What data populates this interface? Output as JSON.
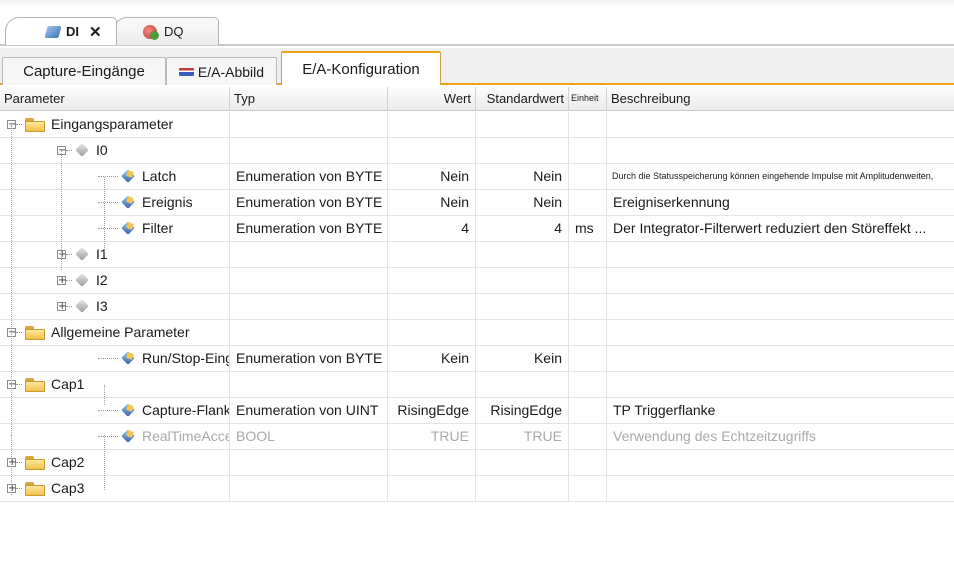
{
  "doc_tabs": [
    {
      "label": "DI",
      "icon": "di-module-icon",
      "close": "✕"
    },
    {
      "label": "DQ",
      "icon": "dq-module-icon"
    }
  ],
  "sub_tabs": [
    {
      "label": "Capture-Eingänge"
    },
    {
      "label": "E/A-Abbild",
      "icon": "io-image-icon"
    },
    {
      "label": "E/A-Konfiguration",
      "active": true
    }
  ],
  "columns": [
    "Parameter",
    "Typ",
    "Wert",
    "Standardwert",
    "Einheit",
    "Beschreibung"
  ],
  "rows": [
    {
      "label": "Eingangsparameter",
      "level": 0,
      "expander": "−",
      "icon": "folder-icon",
      "typ": "",
      "wert": "",
      "std": "",
      "einheit": "",
      "desc": ""
    },
    {
      "label": "I0",
      "level": 1,
      "expander": "−",
      "icon": "channel-icon",
      "typ": "",
      "wert": "",
      "std": "",
      "einheit": "",
      "desc": ""
    },
    {
      "label": "Latch",
      "level": 2,
      "expander": "",
      "icon": "parameter-icon",
      "typ": "Enumeration von BYTE",
      "wert": "Nein",
      "std": "Nein",
      "einheit": "",
      "desc": "Durch die Statusspeicherung können eingehende Impulse mit Amplitudenweiten,",
      "desc_small": true
    },
    {
      "label": "Ereignis",
      "level": 2,
      "expander": "",
      "icon": "parameter-icon",
      "typ": "Enumeration von BYTE",
      "wert": "Nein",
      "std": "Nein",
      "einheit": "",
      "desc": "Ereigniserkennung"
    },
    {
      "label": "Filter",
      "level": 2,
      "expander": "",
      "icon": "parameter-icon",
      "typ": "Enumeration von BYTE",
      "wert": "4",
      "std": "4",
      "einheit": "ms",
      "desc": "Der Integrator-Filterwert reduziert den Störeffekt ..."
    },
    {
      "label": "I1",
      "level": 1,
      "expander": "+",
      "icon": "channel-icon",
      "typ": "",
      "wert": "",
      "std": "",
      "einheit": "",
      "desc": ""
    },
    {
      "label": "I2",
      "level": 1,
      "expander": "+",
      "icon": "channel-icon",
      "typ": "",
      "wert": "",
      "std": "",
      "einheit": "",
      "desc": ""
    },
    {
      "label": "I3",
      "level": 1,
      "expander": "+",
      "icon": "channel-icon",
      "typ": "",
      "wert": "",
      "std": "",
      "einheit": "",
      "desc": ""
    },
    {
      "label": "Allgemeine Parameter",
      "level": 0,
      "expander": "−",
      "icon": "folder-icon",
      "typ": "",
      "wert": "",
      "std": "",
      "einheit": "",
      "desc": ""
    },
    {
      "label": "Run/Stop-Eingang",
      "level": 2,
      "expander": "",
      "icon": "parameter-icon",
      "typ": "Enumeration von BYTE",
      "wert": "Kein",
      "std": "Kein",
      "einheit": "",
      "desc": ""
    },
    {
      "label": "Cap1",
      "level": 0,
      "expander": "−",
      "icon": "folder-icon",
      "typ": "",
      "wert": "",
      "std": "",
      "einheit": "",
      "desc": ""
    },
    {
      "label": "Capture-Flanke",
      "level": 2,
      "expander": "",
      "icon": "parameter-icon",
      "typ": "Enumeration von UINT",
      "wert": "RisingEdge",
      "std": "RisingEdge",
      "einheit": "",
      "desc": "TP Triggerflanke"
    },
    {
      "label": "RealTimeAccess",
      "level": 2,
      "expander": "",
      "icon": "parameter-icon",
      "typ": "BOOL",
      "wert": "TRUE",
      "std": "TRUE",
      "einheit": "",
      "desc": "Verwendung des Echtzeitzugriffs",
      "dim": true
    },
    {
      "label": "Cap2",
      "level": 0,
      "expander": "+",
      "icon": "folder-icon",
      "typ": "",
      "wert": "",
      "std": "",
      "einheit": "",
      "desc": ""
    },
    {
      "label": "Cap3",
      "level": 0,
      "expander": "+",
      "icon": "folder-icon",
      "typ": "",
      "wert": "",
      "std": "",
      "einheit": "",
      "desc": ""
    }
  ]
}
